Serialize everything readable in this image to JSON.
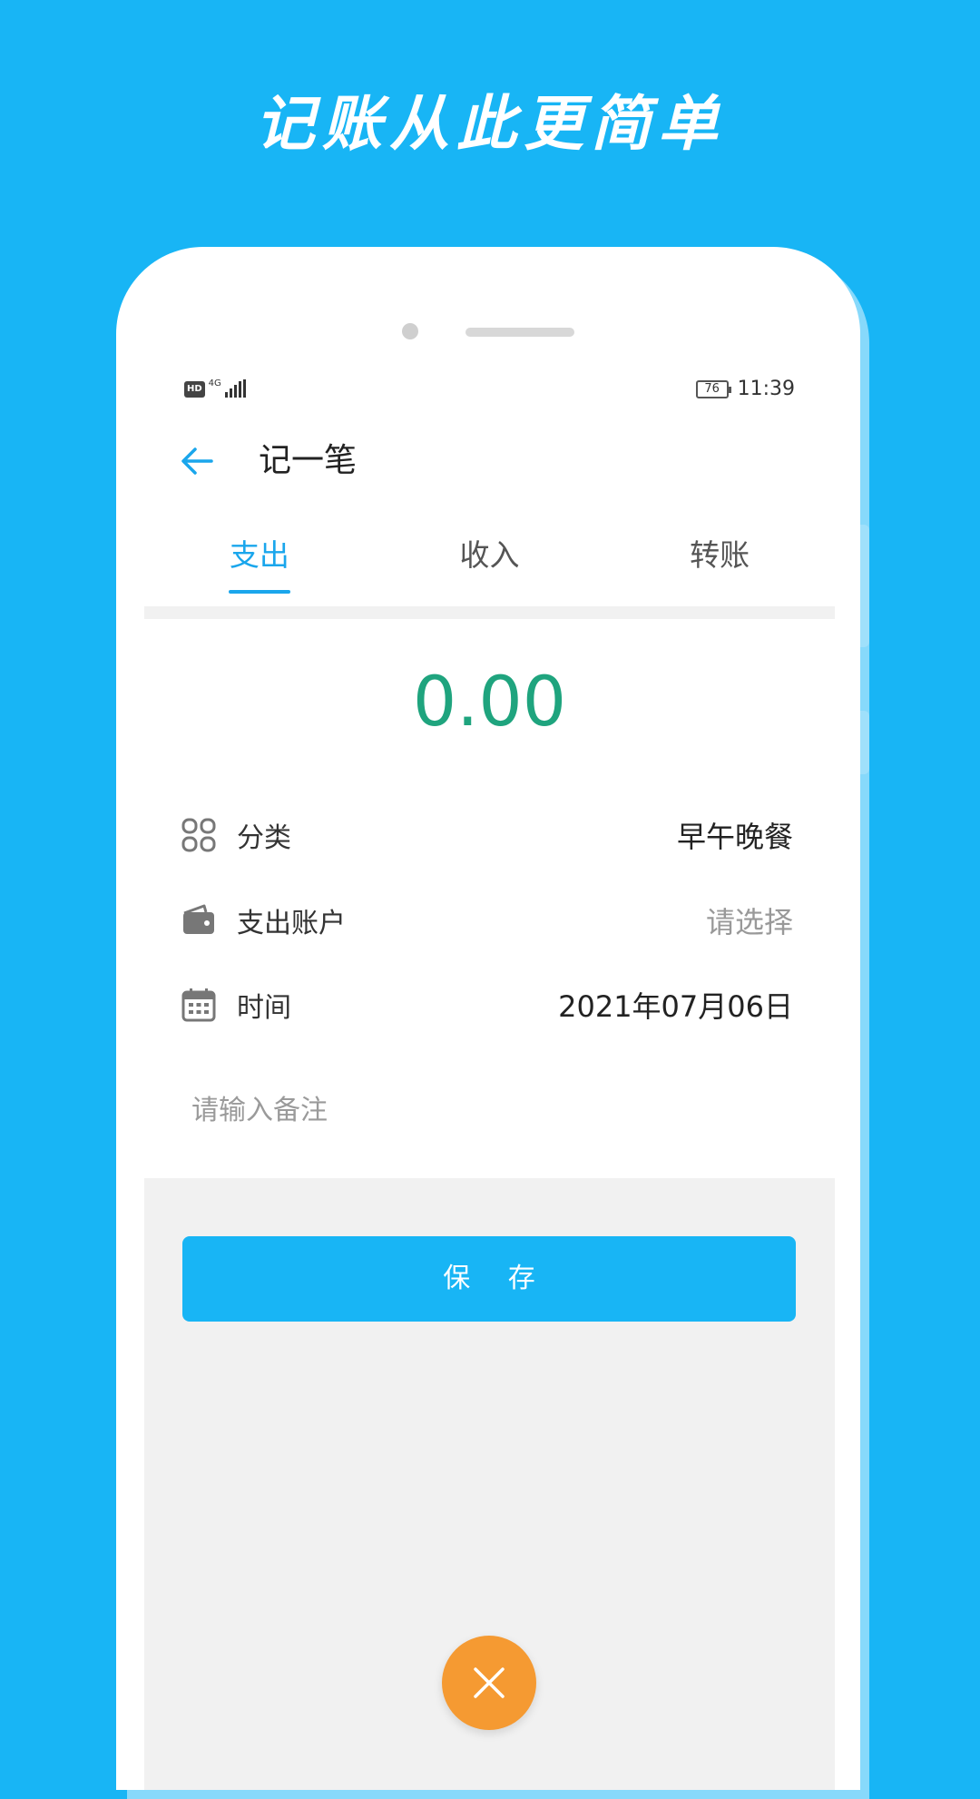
{
  "promo": {
    "headline": "记账从此更简单"
  },
  "status_bar": {
    "hd": "HD",
    "network": "4G",
    "battery": "76",
    "time": "11:39"
  },
  "header": {
    "title": "记一笔",
    "back_icon": "arrow-left-icon"
  },
  "tabs": [
    {
      "label": "支出",
      "active": true
    },
    {
      "label": "收入",
      "active": false
    },
    {
      "label": "转账",
      "active": false
    }
  ],
  "amount": "0.00",
  "form": {
    "category": {
      "label": "分类",
      "value": "早午晚餐",
      "icon": "category-grid-icon"
    },
    "account": {
      "label": "支出账户",
      "value": "请选择",
      "icon": "wallet-icon"
    },
    "time": {
      "label": "时间",
      "value": "2021年07月06日",
      "icon": "calendar-icon"
    },
    "note": {
      "placeholder": "请输入备注",
      "value": ""
    }
  },
  "actions": {
    "save_label": "保 存",
    "close_icon": "close-icon"
  },
  "colors": {
    "background": "#18b5f5",
    "accent": "#1aa6ec",
    "amount": "#1fa47e",
    "fab": "#f59a32"
  }
}
